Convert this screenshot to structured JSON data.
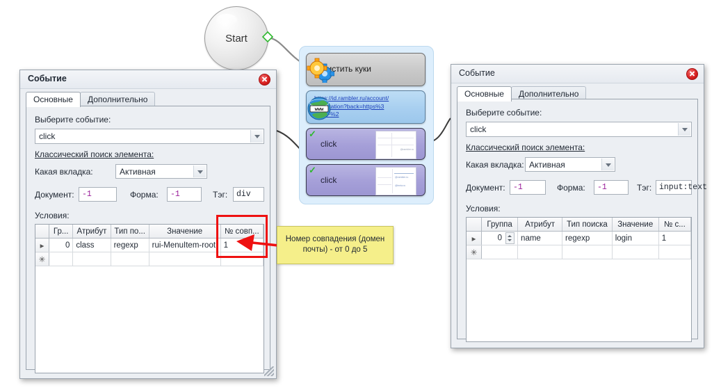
{
  "diagram": {
    "start_node": {
      "label": "Start"
    },
    "nodes": [
      {
        "type": "cookie-node",
        "label": "Очистить куки",
        "icon": "gears-icon"
      },
      {
        "type": "url-node",
        "label": "https://id.rambler.ru/account/registration?back=https%3A%2F%2",
        "icon": "globe-www-icon"
      },
      {
        "type": "click-node",
        "label": "click",
        "status_icon": "green-check-icon",
        "thumb_texts": [
          "@rambler.ru"
        ]
      },
      {
        "type": "click-node",
        "label": "click",
        "status_icon": "green-check-icon",
        "thumb_texts": [
          "@rambler.ru",
          "@lenta.ru"
        ]
      }
    ]
  },
  "annotation": {
    "note_text": "Номер совпадения (домен почты) - от 0 до 5",
    "highlight": "red-box-around-match-number-column",
    "arrow": "red-arrow-icon"
  },
  "left_dialog": {
    "title": "Событие",
    "close_icon": "close-icon",
    "tabs": [
      {
        "label": "Основные",
        "selected": true
      },
      {
        "label": "Дополнительно",
        "selected": false
      }
    ],
    "event_label": "Выберите событие:",
    "event_value": "click",
    "classic_search_link": "Классический поиск элемента:",
    "tab_label": "Какая вкладка:",
    "tab_value": "Активная",
    "document_label": "Документ:",
    "document_value": "-1",
    "form_label": "Форма:",
    "form_value": "-1",
    "tag_label": "Тэг:",
    "tag_value": "div",
    "conditions_label": "Условия:",
    "grid": {
      "headers": [
        "",
        "Гр...",
        "Атрибут",
        "Тип по...",
        "Значение",
        "№ совп..."
      ],
      "rows": [
        {
          "marker": "▸",
          "group": "0",
          "attribute": "class",
          "search_type": "regexp",
          "value": "rui-MenuItem-root",
          "match_no": "1"
        },
        {
          "marker": "✳",
          "group": "",
          "attribute": "",
          "search_type": "",
          "value": "",
          "match_no": ""
        }
      ]
    }
  },
  "right_dialog": {
    "title": "Событие",
    "close_icon": "close-icon",
    "tabs": [
      {
        "label": "Основные",
        "selected": true
      },
      {
        "label": "Дополнительно",
        "selected": false
      }
    ],
    "event_label": "Выберите событие:",
    "event_value": "click",
    "classic_search_link": "Классический поиск элемента:",
    "tab_label": "Какая вкладка:",
    "tab_value": "Активная",
    "document_label": "Документ:",
    "document_value": "-1",
    "form_label": "Форма:",
    "form_value": "-1",
    "tag_label": "Тэг:",
    "tag_value": "input:text",
    "conditions_label": "Условия:",
    "grid": {
      "headers": [
        "",
        "Группа",
        "Атрибут",
        "Тип поиска",
        "Значение",
        "№ с..."
      ],
      "rows": [
        {
          "marker": "▸",
          "group": "0",
          "attribute": "name",
          "search_type": "regexp",
          "value": "login",
          "match_no": "1"
        },
        {
          "marker": "✳",
          "group": "",
          "attribute": "",
          "search_type": "",
          "value": "",
          "match_no": ""
        }
      ]
    }
  },
  "colors": {
    "accent_red": "#ee1111",
    "note_yellow": "#f5ef8a",
    "group_blue": "#ddeefc",
    "click_purple": "#a59fd8",
    "link_blue": "#1b3fbb"
  }
}
